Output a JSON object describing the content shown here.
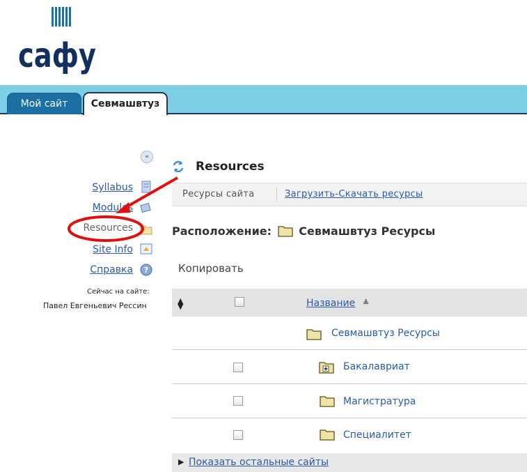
{
  "logo": {
    "text": "сафу"
  },
  "tabs": [
    {
      "label": "Мой сайт",
      "active": false
    },
    {
      "label": "Севмашвтуз",
      "active": true
    }
  ],
  "sidebar": {
    "items": [
      {
        "label": "Syllabus",
        "icon": "syllabus-icon"
      },
      {
        "label": "Modules",
        "icon": "modules-icon"
      },
      {
        "label": "Resources",
        "icon": "folder-icon",
        "current": true
      },
      {
        "label": "Site Info",
        "icon": "site-info-icon"
      },
      {
        "label": "Справка",
        "icon": "help-icon"
      }
    ],
    "presence_label": "Сейчас на сайте:",
    "presence_user": "Павел Евгеньевич Рессин"
  },
  "main": {
    "title": "Resources",
    "toolbar": {
      "current": "Ресурсы сайта",
      "link": "Загрузить-Скачать ресурсы"
    },
    "location_label": "Расположение:",
    "location_value": "Севмашвтуз Ресурсы",
    "copy_action": "Копировать",
    "table": {
      "column_name": "Название",
      "rows": [
        {
          "name": "Севмашвтуз Ресурсы",
          "checkbox": false,
          "expandable": false
        },
        {
          "name": "Бакалавриат",
          "checkbox": true,
          "expandable": true
        },
        {
          "name": "Магистратура",
          "checkbox": true,
          "expandable": false
        },
        {
          "name": "Специалитет",
          "checkbox": true,
          "expandable": false
        }
      ]
    },
    "footer_link": "Показать остальные сайты"
  },
  "colors": {
    "tab_band": "#7ecfe6",
    "tab_active_border": "#1d3a5c",
    "link": "#2a5aa8",
    "annotation": "#e01010"
  }
}
